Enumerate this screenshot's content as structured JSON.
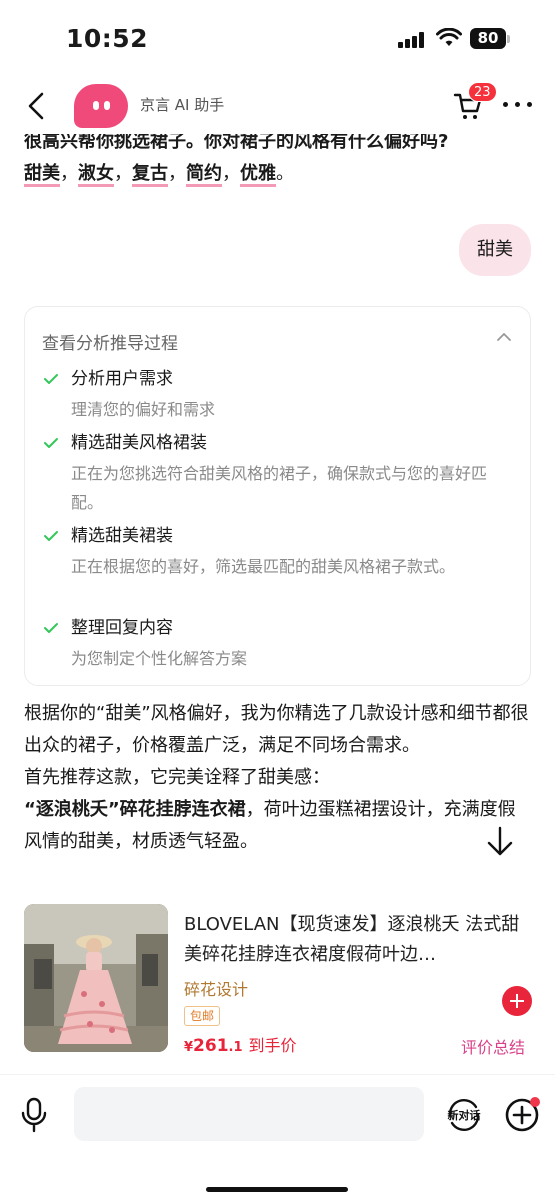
{
  "status_bar": {
    "time": "10:52",
    "battery": "80"
  },
  "header": {
    "title": "京言 AI 助手",
    "cart_count": "23"
  },
  "intro": {
    "question": "很高兴帮你挑选裙子。你对裙子的风格有什么偏好吗?",
    "options": [
      "甜美",
      "淑女",
      "复古",
      "简约",
      "优雅"
    ],
    "separator": "，",
    "end": "。"
  },
  "user_message": "甜美",
  "analysis": {
    "title": "查看分析推导过程",
    "steps": [
      {
        "title": "分析用户需求",
        "desc": "理清您的偏好和需求"
      },
      {
        "title": "精选甜美风格裙装",
        "desc": "正在为您挑选符合甜美风格的裙子，确保款式与您的喜好匹配。"
      },
      {
        "title": "精选甜美裙装",
        "desc": "正在根据您的喜好，筛选最匹配的甜美风格裙子款式。"
      },
      {
        "title": "整理回复内容",
        "desc": "为您制定个性化解答方案"
      }
    ]
  },
  "reply": {
    "p1": "根据你的“甜美”风格偏好，我为你精选了几款设计感和细节都很出众的裙子，价格覆盖广泛，满足不同场合需求。",
    "p2": "首先推荐这款，它完美诠释了甜美感：",
    "p3_bold": "“逐浪桃夭”碎花挂脖连衣裙",
    "p3_rest": "，荷叶边蛋糕裙摆设计，充满度假风情的甜美，材质透气轻盈。"
  },
  "product": {
    "name": "BLOVELAN【现货速发】逐浪桃夭 法式甜美碎花挂脖连衣裙度假荷叶边…",
    "tag": "碎花设计",
    "shipping": "包邮",
    "currency": "¥",
    "price_int": "261",
    "price_dec": ".1",
    "price_suffix": "到手价",
    "review_label": "评价总结"
  },
  "input_bar": {
    "placeholder": "",
    "new_chat_label": "新对话"
  },
  "colors": {
    "accent": "#f04a7a",
    "price": "#e8243a",
    "check": "#34c759",
    "user_bubble": "#fbe3ea"
  }
}
